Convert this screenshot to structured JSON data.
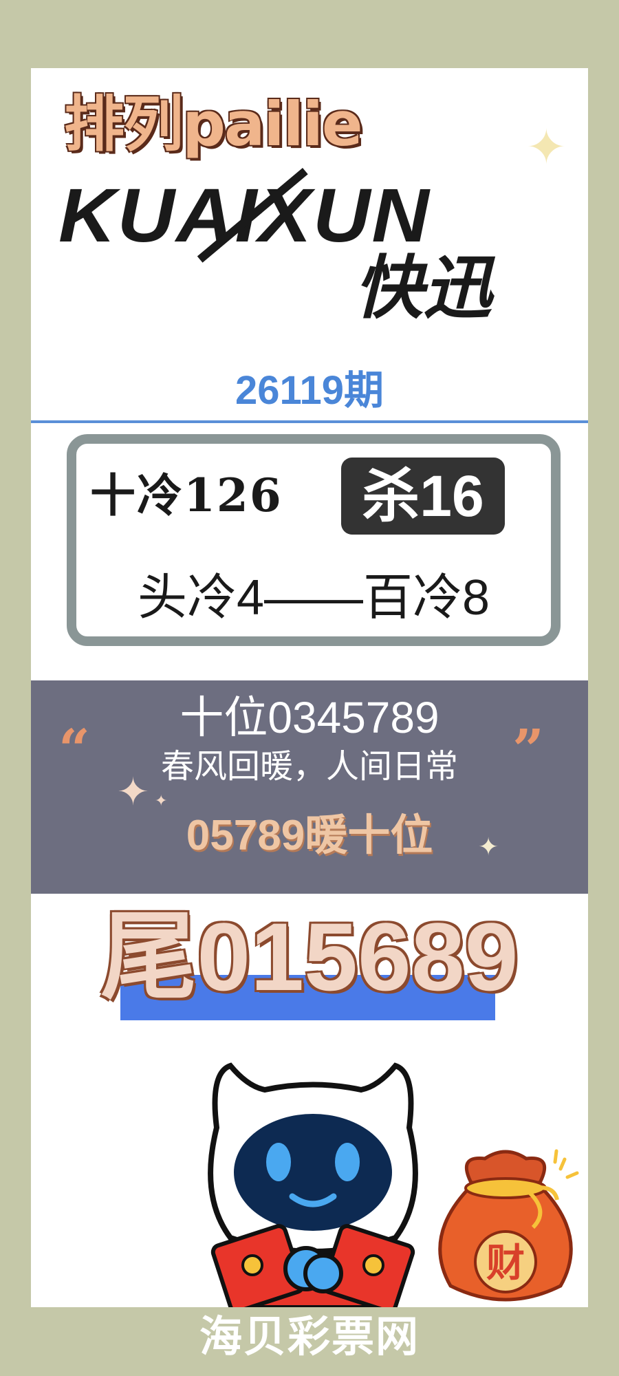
{
  "header": {
    "brand_cn_top": "排列pailie",
    "brand_en": "KUAIXUN",
    "brand_cn_bottom": "快迅"
  },
  "issue": {
    "label": "26119期"
  },
  "kill_box": {
    "ten_cold": "十冷126",
    "kill_badge": "杀16",
    "head_cold": "头冷4——百冷8"
  },
  "quote_band": {
    "title": "十位0345789",
    "subtitle": "春风回暖，人间日常",
    "highlight": "05789暖十位",
    "open_quote": "“",
    "close_quote": "”"
  },
  "tail": {
    "label": "尾015689"
  },
  "moneybag": {
    "label": "财"
  },
  "footer": {
    "label": "海贝彩票网"
  },
  "colors": {
    "page_bg": "#c5c8a8",
    "issue_blue": "#4a86d8",
    "band_bg": "#6d6e80",
    "accent_orange": "#e8956a",
    "tail_bar_blue": "#4a7ae8"
  }
}
